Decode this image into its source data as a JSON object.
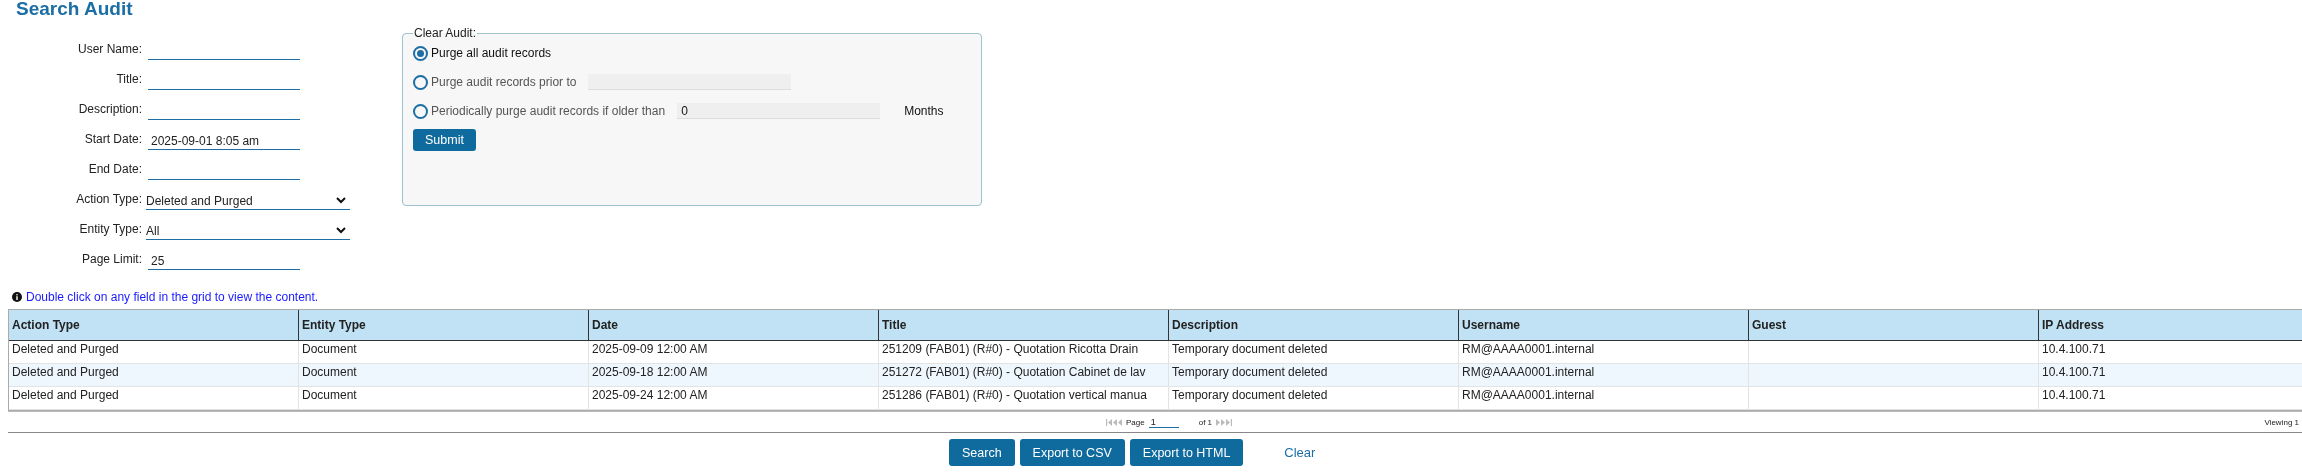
{
  "title": "Search Audit",
  "form": [
    {
      "kind": "text",
      "label": "User Name:"
    },
    {
      "kind": "text",
      "label": "Title:"
    },
    {
      "kind": "text",
      "label": "Description:"
    },
    {
      "kind": "text",
      "label": "Start Date:",
      "value": "2025-09-01 8:05 am"
    },
    {
      "kind": "text",
      "label": "End Date:"
    },
    {
      "kind": "select",
      "label": "Action Type:",
      "value": "Deleted and Purged"
    },
    {
      "kind": "select",
      "label": "Entity Type:",
      "value": "All"
    },
    {
      "kind": "text",
      "label": "Page Limit:",
      "value": "25"
    }
  ],
  "clear_audit": {
    "legend": "Clear Audit:",
    "options": [
      {
        "kind": "plain",
        "label": "Purge all audit records",
        "selected": true
      },
      {
        "kind": "field",
        "label": "Purge audit records prior to",
        "selected": false
      },
      {
        "kind": "field",
        "label": "Periodically purge audit records if older than",
        "selected": false,
        "value": "0",
        "suffix": "Months"
      }
    ],
    "submit": "Submit"
  },
  "hint": "Double click on any field in the grid to view the content.",
  "table": {
    "columns": [
      "Action Type",
      "Entity Type",
      "Date",
      "Title",
      "Description",
      "Username",
      "Guest",
      "IP Address"
    ],
    "rows": [
      [
        "Deleted and Purged",
        "Document",
        "2025-09-09 12:00 AM",
        "251209 (FAB01) (R#0) - Quotation Ricotta Drain",
        "Temporary document deleted",
        "RM@AAAA0001.internal",
        "",
        "10.4.100.71"
      ],
      [
        "Deleted and Purged",
        "Document",
        "2025-09-18 12:00 AM",
        "251272 (FAB01) (R#0) - Quotation Cabinet de lav",
        "Temporary document deleted",
        "RM@AAAA0001.internal",
        "",
        "10.4.100.71"
      ],
      [
        "Deleted and Purged",
        "Document",
        "2025-09-24 12:00 AM",
        "251286 (FAB01) (R#0) - Quotation vertical manua",
        "Temporary document deleted",
        "RM@AAAA0001.internal",
        "",
        "10.4.100.71"
      ]
    ]
  },
  "pager": {
    "page_label": "Page",
    "page": "1",
    "of": "of 1",
    "viewing": "Viewing 1"
  },
  "buttons": [
    {
      "kind": "button",
      "label": "Search"
    },
    {
      "kind": "button",
      "label": "Export to CSV"
    },
    {
      "kind": "button",
      "label": "Export to HTML"
    },
    {
      "kind": "link",
      "label": "Clear"
    }
  ]
}
